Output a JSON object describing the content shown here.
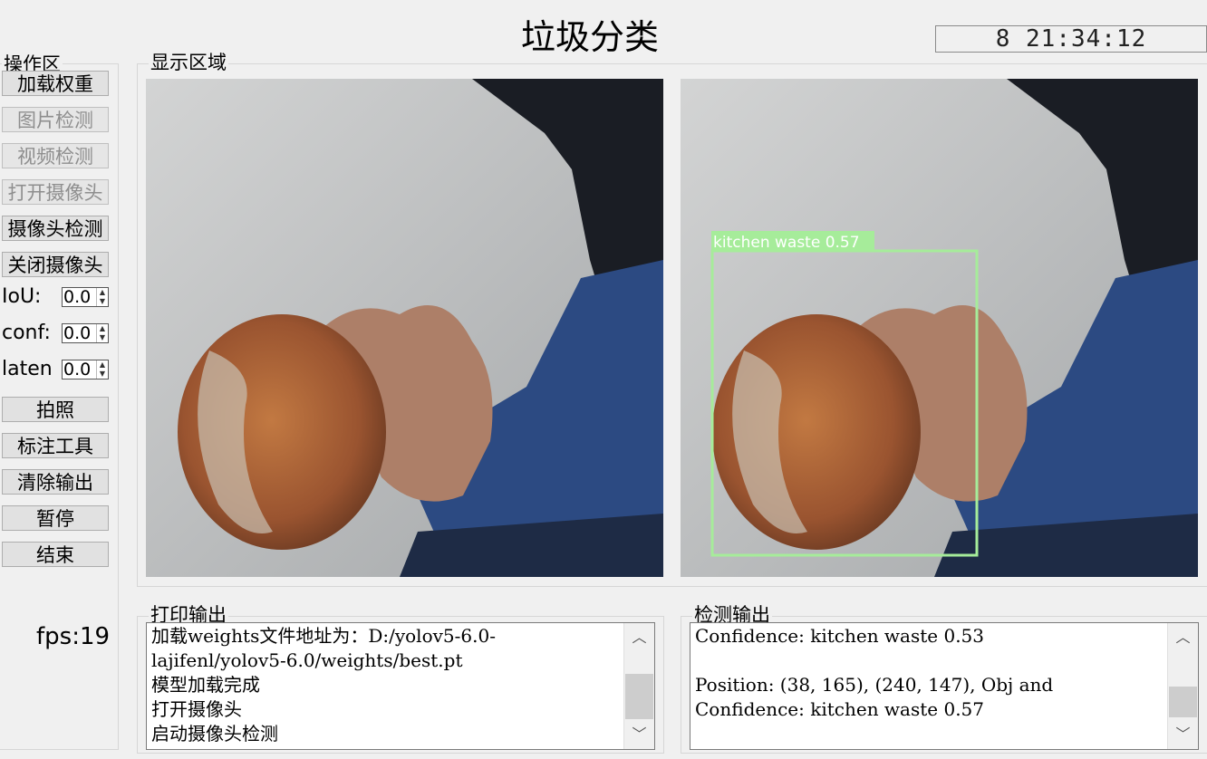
{
  "window": {
    "title": "垃圾分类",
    "clock": "8 21:34:12"
  },
  "sidebar": {
    "title": "操作区",
    "buttons": [
      {
        "label": "加载权重",
        "enabled": true
      },
      {
        "label": "图片检测",
        "enabled": false
      },
      {
        "label": "视频检测",
        "enabled": false
      },
      {
        "label": "打开摄像头",
        "enabled": false
      },
      {
        "label": "摄像头检测",
        "enabled": true
      },
      {
        "label": "关闭摄像头",
        "enabled": true
      }
    ],
    "params": [
      {
        "label": "IoU:",
        "value": "0.0"
      },
      {
        "label": "conf:",
        "value": "0.0"
      },
      {
        "label": "laten",
        "value": "0.0"
      }
    ],
    "actions": [
      {
        "label": "拍照"
      },
      {
        "label": "标注工具"
      },
      {
        "label": "清除输出"
      },
      {
        "label": "暂停"
      },
      {
        "label": "结束"
      }
    ],
    "fps": "fps:19"
  },
  "display": {
    "title": "显示区域",
    "detection_label": "kitchen waste 0.57",
    "box_color": "#a6ec9a"
  },
  "print_output": {
    "title": "打印输出",
    "lines": [
      "加载weights文件地址为：D:/yolov5-6.0-",
      "lajifenl/yolov5-6.0/weights/best.pt",
      "模型加载完成",
      "打开摄像头",
      "启动摄像头检测"
    ]
  },
  "detect_output": {
    "title": "检测输出",
    "lines": [
      "Confidence: kitchen waste 0.53",
      "",
      "Position: (38, 165), (240, 147), Obj and",
      "Confidence: kitchen waste 0.57"
    ]
  }
}
